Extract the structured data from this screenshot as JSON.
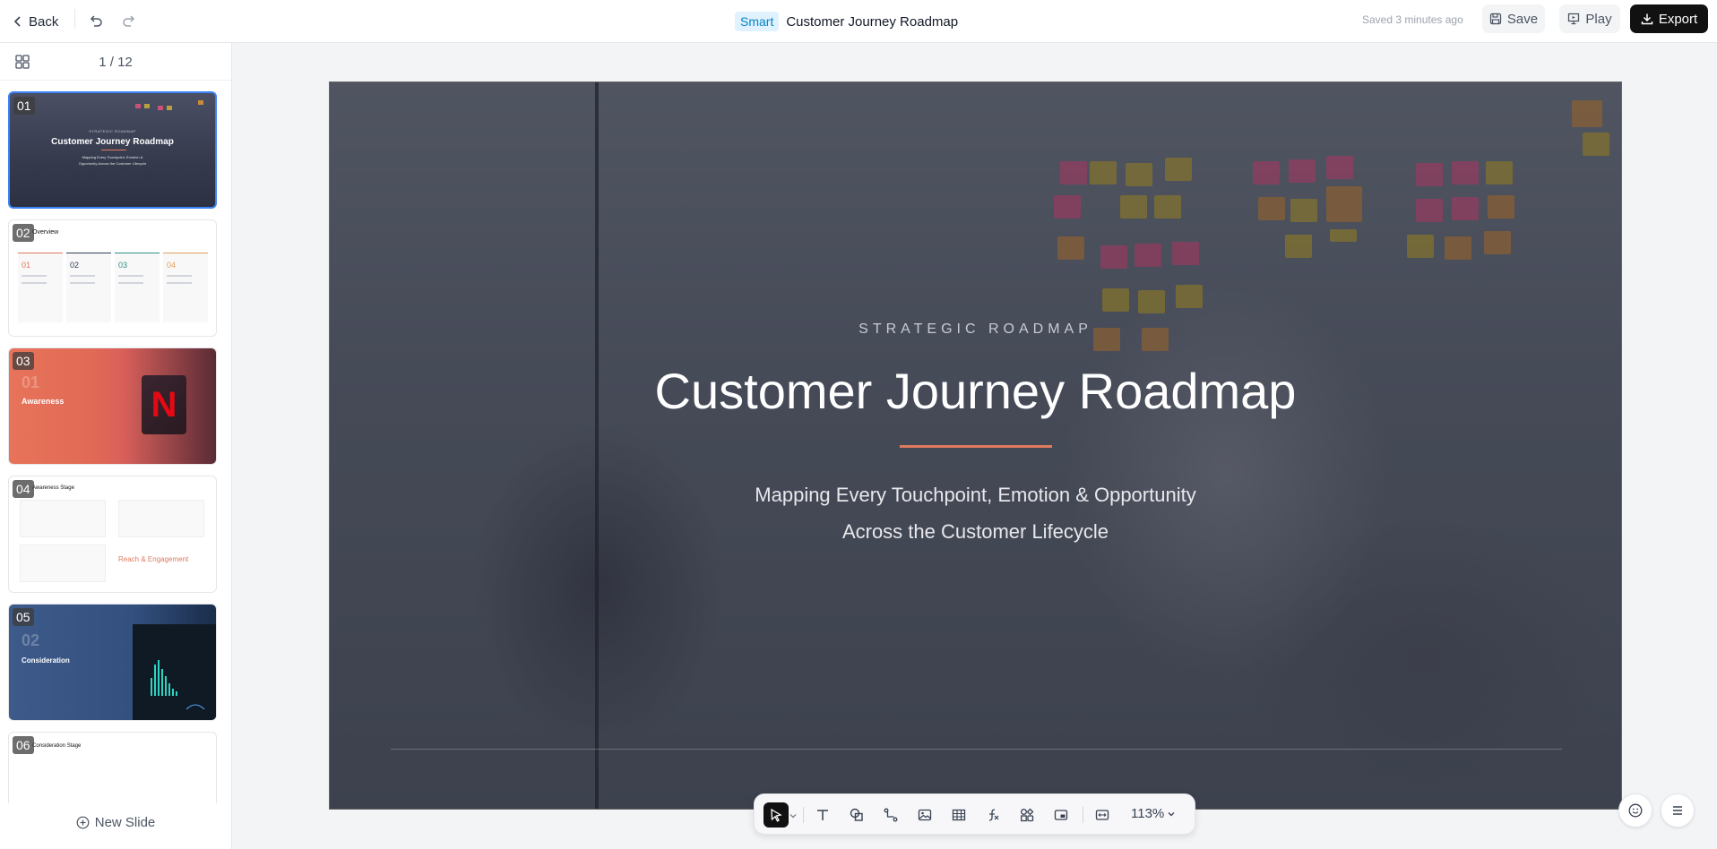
{
  "topbar": {
    "back_label": "Back",
    "badge": "Smart",
    "title": "Customer Journey Roadmap",
    "saved": "Saved 3 minutes ago",
    "save_label": "Save",
    "play_label": "Play",
    "export_label": "Export"
  },
  "sidebar": {
    "page_count": "1 / 12",
    "new_slide_label": "New Slide",
    "thumbnails": [
      {
        "num": "01",
        "eyebrow": "STRATEGIC ROADMAP",
        "title": "Customer Journey Roadmap",
        "subtitle": "Mapping Every Touchpoint, Emotion & Opportunity Across the Customer Lifecycle"
      },
      {
        "num": "02",
        "title": "Overview",
        "cols": [
          "01",
          "02",
          "03",
          "04"
        ]
      },
      {
        "num": "03",
        "big": "01",
        "title": "Awareness"
      },
      {
        "num": "04",
        "title": "Awareness Stage",
        "orange": "Reach & Engagement"
      },
      {
        "num": "05",
        "big": "02",
        "title": "Consideration"
      },
      {
        "num": "06",
        "title": "Consideration Stage"
      }
    ]
  },
  "slide": {
    "eyebrow": "STRATEGIC ROADMAP",
    "title": "Customer Journey Roadmap",
    "subtitle_line1": "Mapping Every Touchpoint, Emotion & Opportunity",
    "subtitle_line2": "Across the Customer Lifecycle",
    "accent_color": "#e07a5f"
  },
  "toolbar": {
    "zoom": "113%",
    "tools": [
      "select-icon",
      "text-icon",
      "shape-icon",
      "connector-icon",
      "image-icon",
      "table-icon",
      "formula-icon",
      "components-icon",
      "media-icon",
      "fit-icon"
    ]
  },
  "colors": {
    "export_bg": "#111111",
    "smart_badge_bg": "#e0f2fe",
    "smart_badge_text": "#0284c7",
    "active_thumb_border": "#3b82f6"
  }
}
